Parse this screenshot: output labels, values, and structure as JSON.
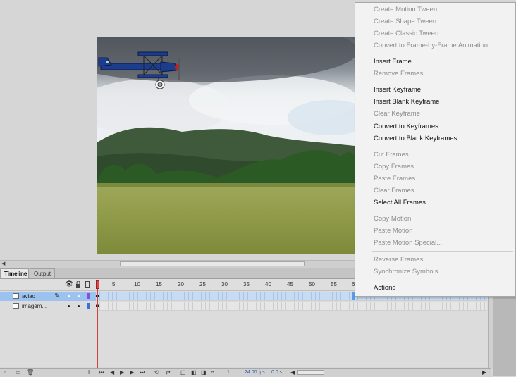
{
  "panel_tabs": [
    "Timeline",
    "Output"
  ],
  "ruler": [
    "1",
    "5",
    "10",
    "15",
    "20",
    "25",
    "30",
    "35",
    "40",
    "45",
    "50",
    "55",
    "6"
  ],
  "layers": [
    {
      "name": "aviao",
      "selected": true
    },
    {
      "name": "imagem...",
      "selected": false
    }
  ],
  "toolbar": {
    "current_frame": "1",
    "fps": "24.00 fps",
    "time": "0.0 s"
  },
  "context_menu": [
    [
      {
        "label": "Create Motion Tween",
        "enabled": false
      },
      {
        "label": "Create Shape Tween",
        "enabled": false
      },
      {
        "label": "Create Classic Tween",
        "enabled": false
      },
      {
        "label": "Convert to Frame-by-Frame Animation",
        "enabled": false
      }
    ],
    [
      {
        "label": "Insert Frame",
        "enabled": true
      },
      {
        "label": "Remove Frames",
        "enabled": false
      }
    ],
    [
      {
        "label": "Insert Keyframe",
        "enabled": true
      },
      {
        "label": "Insert Blank Keyframe",
        "enabled": true
      },
      {
        "label": "Clear Keyframe",
        "enabled": false
      },
      {
        "label": "Convert to Keyframes",
        "enabled": true
      },
      {
        "label": "Convert to Blank Keyframes",
        "enabled": true
      }
    ],
    [
      {
        "label": "Cut Frames",
        "enabled": false
      },
      {
        "label": "Copy Frames",
        "enabled": false
      },
      {
        "label": "Paste Frames",
        "enabled": false
      },
      {
        "label": "Clear Frames",
        "enabled": false
      },
      {
        "label": "Select All Frames",
        "enabled": true
      }
    ],
    [
      {
        "label": "Copy Motion",
        "enabled": false
      },
      {
        "label": "Paste Motion",
        "enabled": false
      },
      {
        "label": "Paste Motion Special...",
        "enabled": false
      }
    ],
    [
      {
        "label": "Reverse Frames",
        "enabled": false
      },
      {
        "label": "Synchronize Symbols",
        "enabled": false
      }
    ],
    [
      {
        "label": "Actions",
        "enabled": true
      }
    ]
  ],
  "colors": {
    "selection": "#9cc3f0",
    "playhead": "#e04848",
    "layer_color_aviao": "#8a4ce0",
    "layer_color_imagem": "#3a6fe0"
  },
  "icons": [
    "eye-icon",
    "lock-icon",
    "outline-icon",
    "pencil-icon",
    "layer-icon",
    "new-layer-icon",
    "new-folder-icon",
    "delete-icon",
    "first-frame-icon",
    "step-back-icon",
    "play-icon",
    "step-forward-icon",
    "last-frame-icon",
    "loop-icon",
    "center-frame-icon",
    "onion-skin-icon",
    "onion-outline-icon",
    "edit-multiple-icon",
    "modify-markers-icon"
  ]
}
